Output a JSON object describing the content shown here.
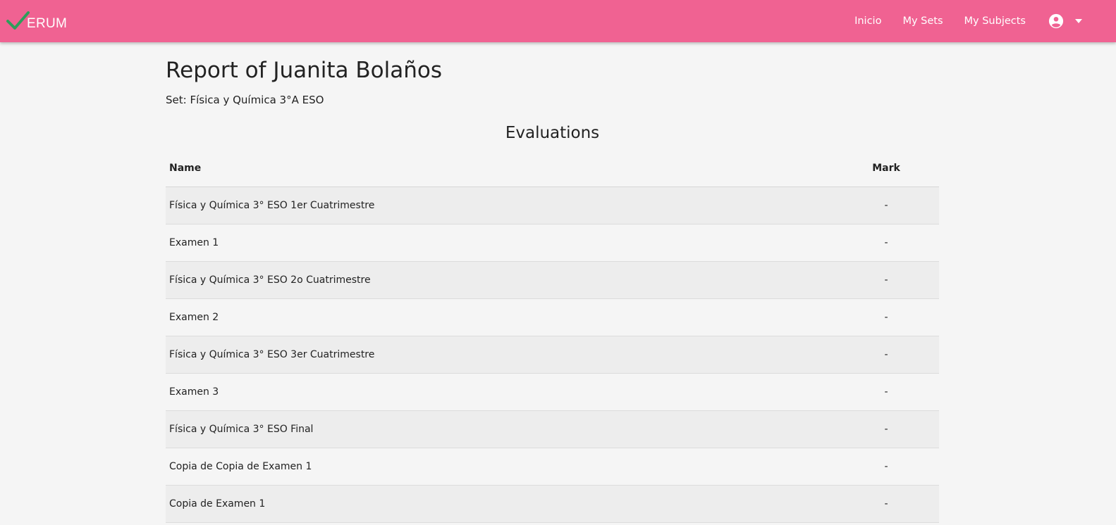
{
  "navbar": {
    "brand_text": "ERUM",
    "brand_color": "#f06292",
    "check_color": "#2e9e5b",
    "links": [
      "Inicio",
      "My Sets",
      "My Subjects"
    ],
    "user_icon": "account-circle-icon",
    "caret_icon": "caret-down-icon"
  },
  "report": {
    "title": "Report of Juanita Bolaños",
    "set_line": "Set: Física y Química 3°A ESO"
  },
  "evaluations": {
    "section_title": "Evaluations",
    "columns": [
      "Name",
      "Mark"
    ],
    "rows": [
      {
        "name": "Física y Química 3° ESO 1er Cuatrimestre",
        "mark": "-"
      },
      {
        "name": "Examen 1",
        "mark": "-"
      },
      {
        "name": "Física y Química 3° ESO 2o Cuatrimestre",
        "mark": "-"
      },
      {
        "name": "Examen 2",
        "mark": "-"
      },
      {
        "name": "Física y Química 3° ESO 3er Cuatrimestre",
        "mark": "-"
      },
      {
        "name": "Examen 3",
        "mark": "-"
      },
      {
        "name": "Física y Química 3° ESO Final",
        "mark": "-"
      },
      {
        "name": "Copia de Copia de Examen 1",
        "mark": "-"
      },
      {
        "name": "Copia de Examen 1",
        "mark": "-"
      }
    ]
  }
}
